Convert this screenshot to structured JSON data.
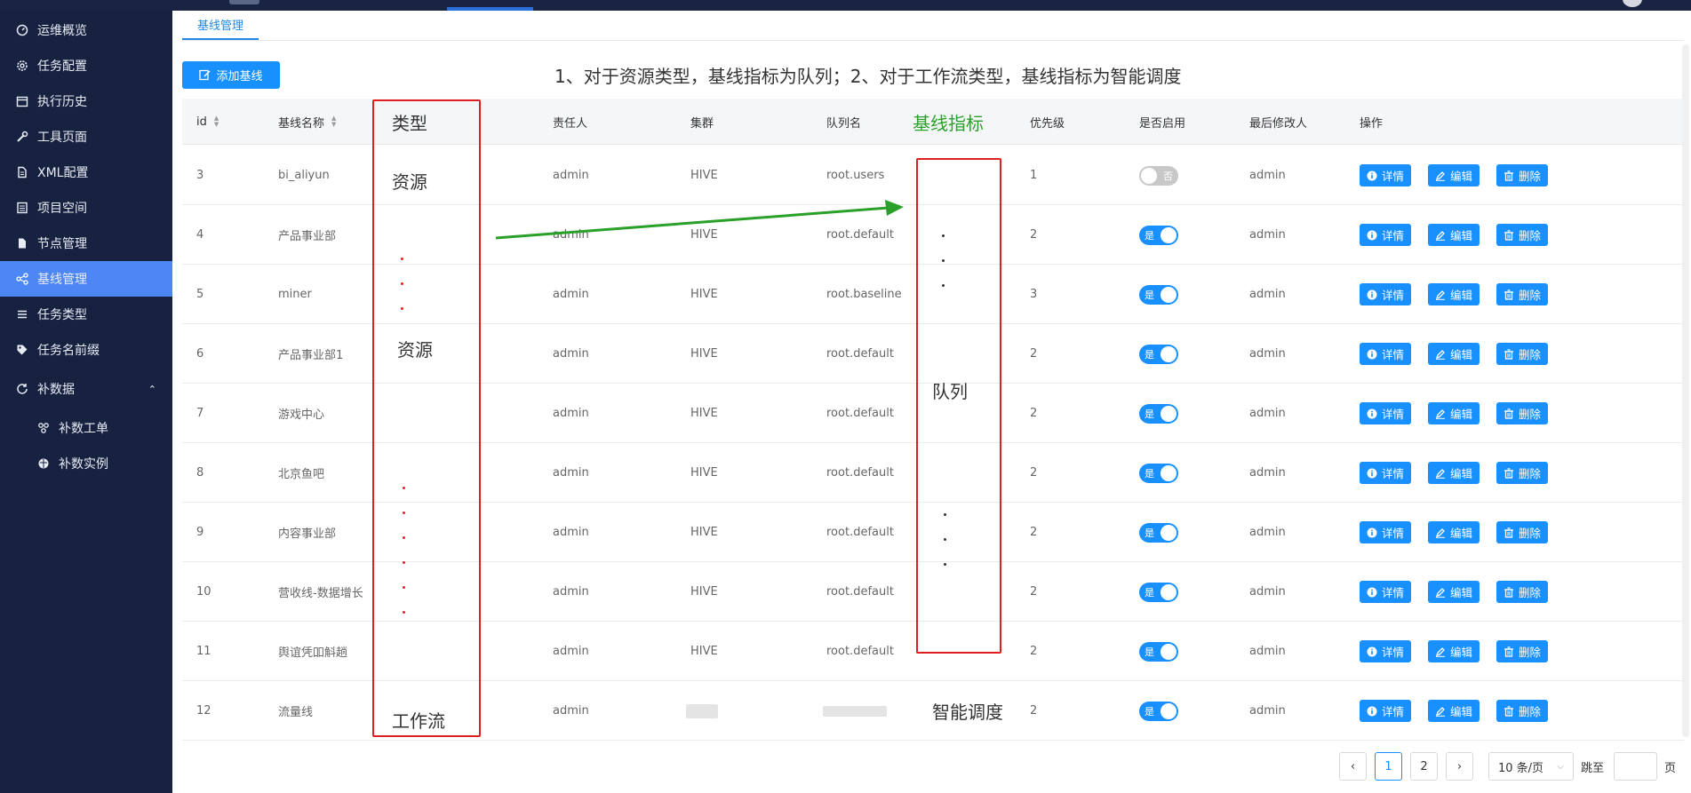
{
  "sidebar": {
    "items": [
      {
        "label": "运维概览",
        "icon": "dashboard-icon"
      },
      {
        "label": "任务配置",
        "icon": "gear-icon"
      },
      {
        "label": "执行历史",
        "icon": "calendar-icon"
      },
      {
        "label": "工具页面",
        "icon": "wrench-icon"
      },
      {
        "label": "XML配置",
        "icon": "document-icon"
      },
      {
        "label": "项目空间",
        "icon": "list-box-icon"
      },
      {
        "label": "节点管理",
        "icon": "file-icon"
      },
      {
        "label": "基线管理",
        "icon": "share-icon"
      },
      {
        "label": "任务类型",
        "icon": "list-icon"
      },
      {
        "label": "任务名前缀",
        "icon": "tag-icon"
      },
      {
        "label": "补数据",
        "icon": "refresh-icon"
      }
    ],
    "sub_items": [
      {
        "label": "补数工单",
        "icon": "cluster-icon"
      },
      {
        "label": "补数实例",
        "icon": "globe-icon"
      }
    ],
    "active_index": 7,
    "active_color": "#4d86f5",
    "background": "#172241"
  },
  "breadcrumb": {
    "tab": "基线管理"
  },
  "toolbar": {
    "add_label": "添加基线"
  },
  "note": "1、对于资源类型，基线指标为队列；2、对于工作流类型，基线指标为智能调度",
  "table": {
    "headers": {
      "id": "id",
      "name": "基线名称",
      "type": "类型",
      "owner": "责任人",
      "cluster": "集群",
      "queue": "队列名",
      "metric": "基线指标",
      "priority": "优先级",
      "enabled": "是否启用",
      "modifier": "最后修改人",
      "actions": "操作"
    },
    "rows": [
      {
        "id": "3",
        "name": "bi_aliyun",
        "type": "资源",
        "owner": "admin",
        "cluster": "HIVE",
        "queue": "root.users",
        "priority": "1",
        "enabled": false,
        "enabled_label": "否",
        "modifier": "admin"
      },
      {
        "id": "4",
        "name": "产品事业部",
        "type": "",
        "owner": "admin",
        "cluster": "HIVE",
        "queue": "root.default",
        "priority": "2",
        "enabled": true,
        "enabled_label": "是",
        "modifier": "admin"
      },
      {
        "id": "5",
        "name": "miner",
        "type": "",
        "owner": "admin",
        "cluster": "HIVE",
        "queue": "root.baseline",
        "priority": "3",
        "enabled": true,
        "enabled_label": "是",
        "modifier": "admin"
      },
      {
        "id": "6",
        "name": "产品事业部1",
        "type": "资源",
        "owner": "admin",
        "cluster": "HIVE",
        "queue": "root.default",
        "priority": "2",
        "enabled": true,
        "enabled_label": "是",
        "modifier": "admin"
      },
      {
        "id": "7",
        "name": "游戏中心",
        "type": "",
        "owner": "admin",
        "cluster": "HIVE",
        "queue": "root.default",
        "priority": "2",
        "enabled": true,
        "enabled_label": "是",
        "modifier": "admin"
      },
      {
        "id": "8",
        "name": "北京鱼吧",
        "type": "",
        "owner": "admin",
        "cluster": "HIVE",
        "queue": "root.default",
        "priority": "2",
        "enabled": true,
        "enabled_label": "是",
        "modifier": "admin"
      },
      {
        "id": "9",
        "name": "内容事业部",
        "type": "",
        "owner": "admin",
        "cluster": "HIVE",
        "queue": "root.default",
        "priority": "2",
        "enabled": true,
        "enabled_label": "是",
        "modifier": "admin"
      },
      {
        "id": "10",
        "name": "营收线-数据增长",
        "type": "",
        "owner": "admin",
        "cluster": "HIVE",
        "queue": "root.default",
        "priority": "2",
        "enabled": true,
        "enabled_label": "是",
        "modifier": "admin"
      },
      {
        "id": "11",
        "name": "舆谊凭吅斛趟",
        "type": "",
        "owner": "admin",
        "cluster": "HIVE",
        "queue": "root.default",
        "priority": "2",
        "enabled": true,
        "enabled_label": "是",
        "modifier": "admin"
      },
      {
        "id": "12",
        "name": "流量线",
        "type": "工作流",
        "owner": "admin",
        "cluster": "",
        "queue": "",
        "metric": "智能调度",
        "priority": "2",
        "enabled": true,
        "enabled_label": "是",
        "modifier": "admin"
      }
    ],
    "actions": {
      "detail": "详情",
      "edit": "编辑",
      "delete": "删除"
    }
  },
  "annotations": {
    "metric_queue": "队列",
    "type_mid": "资源"
  },
  "pagination": {
    "prev": "‹",
    "pages": [
      "1",
      "2"
    ],
    "current": "1",
    "next": "›",
    "page_size": "10 条/页",
    "jump_label": "跳至",
    "page_suffix": "页"
  },
  "colors": {
    "primary": "#1890ff",
    "annotation_red": "#e02020",
    "annotation_green": "#2aa02a"
  }
}
